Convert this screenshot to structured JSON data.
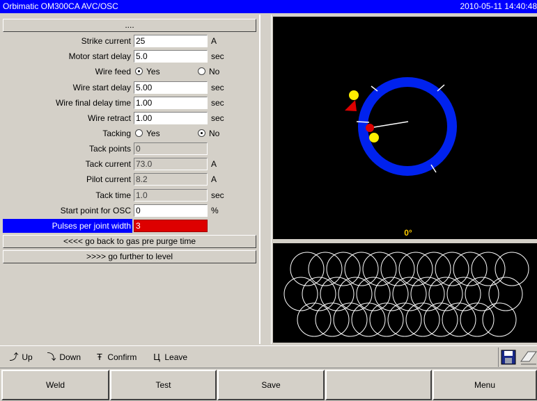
{
  "window": {
    "title": "Orbimatic OM300CA AVC/OSC",
    "datetime": "2010-05-11 14:40:48"
  },
  "panel": {
    "header_button": "....",
    "rows": [
      {
        "label": "Strike current",
        "value": "25",
        "unit": "A"
      },
      {
        "label": "Motor start delay",
        "value": "5.0",
        "unit": "sec"
      },
      {
        "label": "Wire feed",
        "options": [
          "Yes",
          "No"
        ],
        "selected": "Yes"
      },
      {
        "label": "Wire start delay",
        "value": "5.00",
        "unit": "sec"
      },
      {
        "label": "Wire final delay time",
        "value": "1.00",
        "unit": "sec"
      },
      {
        "label": "Wire retract",
        "value": "1.00",
        "unit": "sec"
      },
      {
        "label": "Tacking",
        "options": [
          "Yes",
          "No"
        ],
        "selected": "No"
      },
      {
        "label": "Tack points",
        "value": "0",
        "unit": ""
      },
      {
        "label": "Tack current",
        "value": "73.0",
        "unit": "A"
      },
      {
        "label": "Pilot current",
        "value": "8.2",
        "unit": "A"
      },
      {
        "label": "Tack time",
        "value": "1.0",
        "unit": "sec"
      },
      {
        "label": "Start point for OSC",
        "value": "0",
        "unit": "%"
      },
      {
        "label": "Pulses per joint width",
        "value": "3",
        "unit": ""
      }
    ],
    "nav_back": "<<<< go back to gas pre purge time",
    "nav_forward": ">>>> go further to level"
  },
  "visual": {
    "angle_readout": "0°",
    "ring_color": "#0022ee",
    "marker_red": "#dd0000",
    "marker_yellow": "#ffee00"
  },
  "hints": {
    "up": "Up",
    "down": "Down",
    "confirm": "Confirm",
    "leave": "Leave",
    "icons": [
      "save-icon",
      "eraser-icon"
    ]
  },
  "buttons": {
    "weld": "Weld",
    "test": "Test",
    "save": "Save",
    "empty": "",
    "menu": "Menu"
  }
}
